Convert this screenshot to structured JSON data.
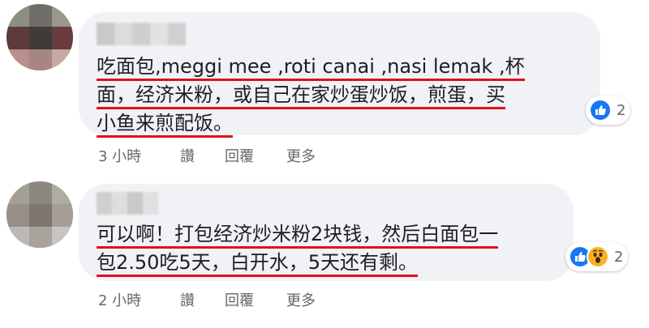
{
  "comments": [
    {
      "author_name": "",
      "text_lines": [
        "吃面包,meggi mee ,roti canai ,nasi lemak ,杯",
        "面，经济米粉，或自己在家炒蛋炒饭，煎蛋，买",
        "小鱼来煎配饭。"
      ],
      "reaction_count": "2",
      "reactions": [
        "like-icon"
      ],
      "timestamp": "3 小時",
      "like_label": "讚",
      "reply_label": "回覆",
      "more_label": "更多"
    },
    {
      "author_name": "",
      "text_lines": [
        "可以啊！打包经济炒米粉2块钱，然后白面包一",
        "包2.50吃5天，白开水，5天还有剩。"
      ],
      "reaction_count": "2",
      "reactions": [
        "like-icon",
        "wow-icon"
      ],
      "timestamp": "2 小時",
      "like_label": "讚",
      "reply_label": "回覆",
      "more_label": "更多"
    }
  ],
  "colors": {
    "bubble": "#f0f2f5",
    "underline": "#e0101c",
    "like": "#1877f2",
    "wow": "#f7b125",
    "meta_text": "#65676b"
  }
}
